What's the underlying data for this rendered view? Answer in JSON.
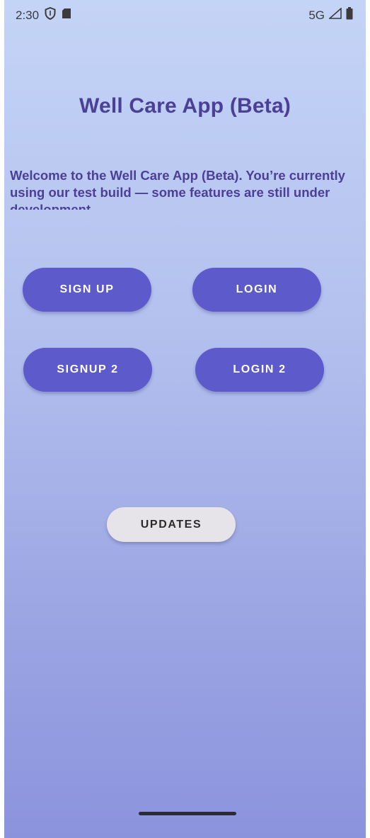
{
  "status_bar": {
    "time": "2:30",
    "network": "5G",
    "icons": [
      "shield-icon",
      "sd-card-icon",
      "signal-icon",
      "battery-icon"
    ]
  },
  "app": {
    "title": "Well Care App (Beta)",
    "welcome_text": "Welcome to the Well Care App (Beta). You’re currently using our test build — some features are still under development."
  },
  "buttons": {
    "sign_up": "SIGN UP",
    "login": "LOGIN",
    "signup_2": "SIGNUP 2",
    "login_2": "LOGIN 2",
    "updates": "UPDATES"
  },
  "colors": {
    "primary": "#5d5acb",
    "title_text": "#4b3f97",
    "secondary_button": "#e6e4e8",
    "background_top": "#c4d4f6",
    "background_bottom": "#8c93dd"
  }
}
